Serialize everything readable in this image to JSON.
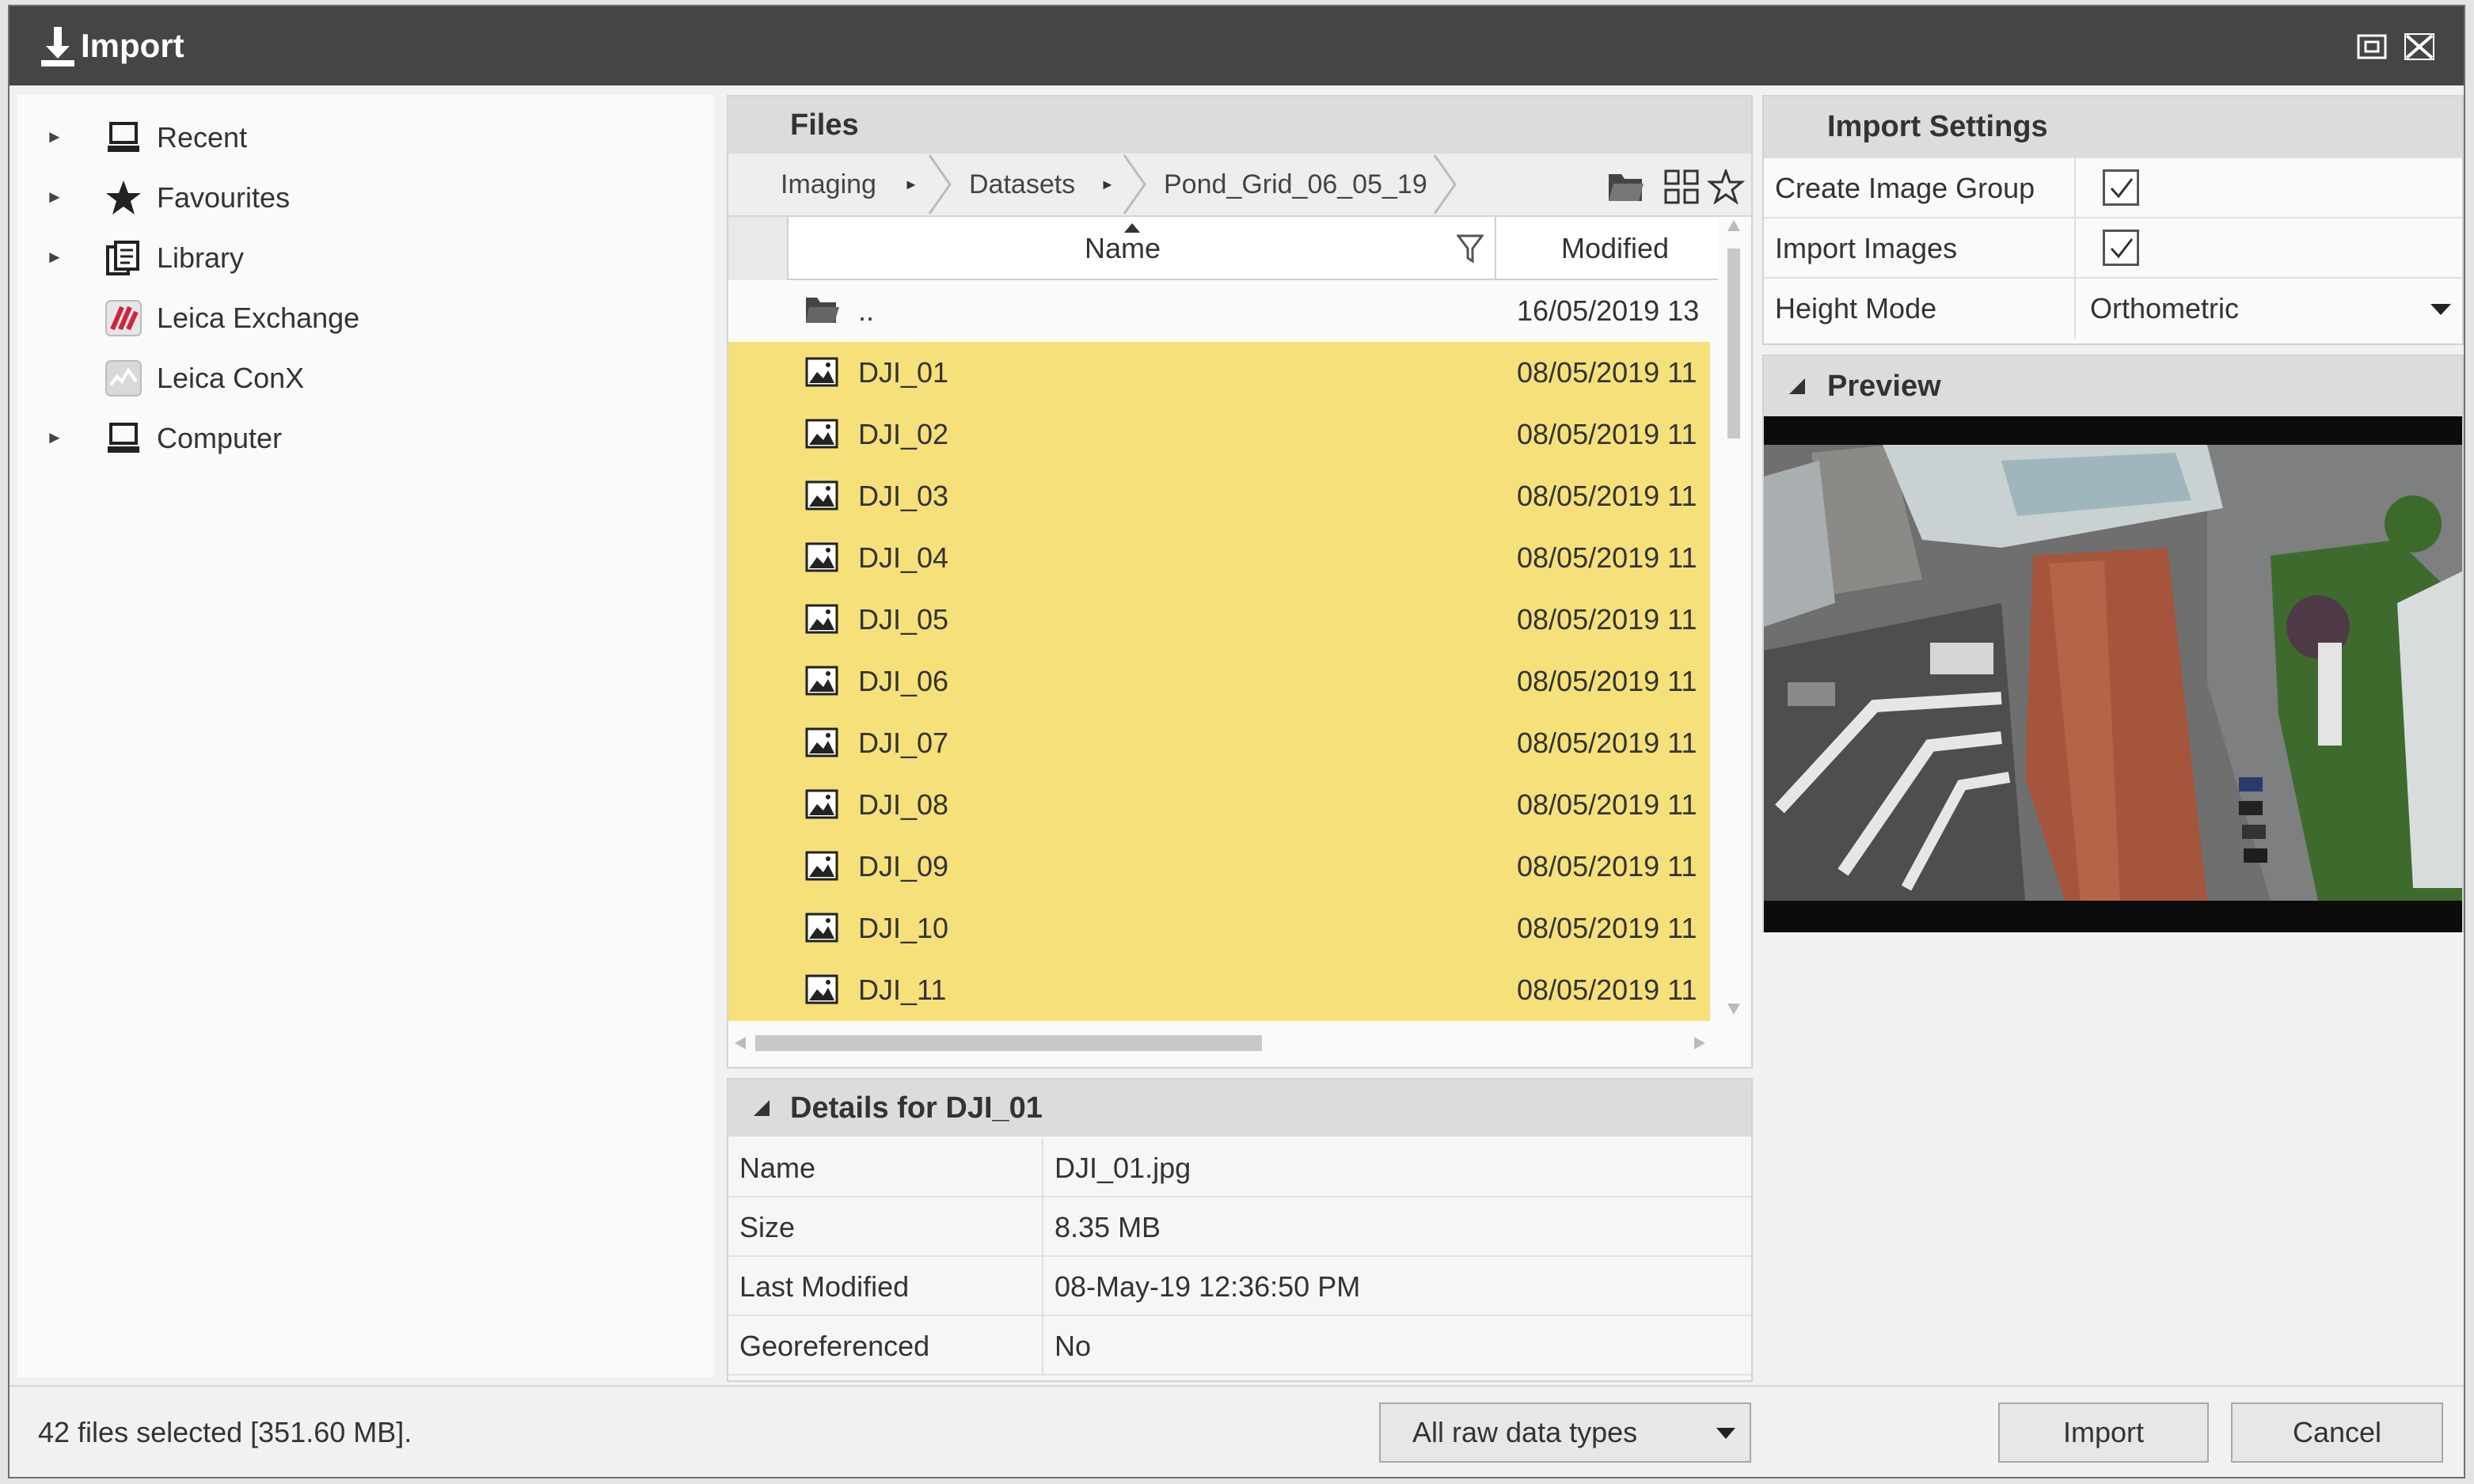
{
  "window": {
    "title": "Import"
  },
  "colors": {
    "title_bar": "#454545",
    "selection": "#f6e07a",
    "panel_header": "#dcdcdc"
  },
  "tree": {
    "items": [
      {
        "label": "Recent",
        "icon": "computer-icon",
        "expandable": true
      },
      {
        "label": "Favourites",
        "icon": "star-icon",
        "expandable": true
      },
      {
        "label": "Library",
        "icon": "library-icon",
        "expandable": true
      },
      {
        "label": "Leica Exchange",
        "icon": "leica-exchange-icon",
        "expandable": false
      },
      {
        "label": "Leica ConX",
        "icon": "leica-conx-icon",
        "expandable": false
      },
      {
        "label": "Computer",
        "icon": "computer-icon",
        "expandable": true
      }
    ]
  },
  "files": {
    "title": "Files",
    "breadcrumb": [
      "Imaging",
      "Datasets",
      "Pond_Grid_06_05_19"
    ],
    "columns": {
      "name": "Name",
      "modified": "Modified"
    },
    "rows": [
      {
        "name": "..",
        "modified": "16/05/2019 13",
        "type": "folder",
        "selected": false
      },
      {
        "name": "DJI_01",
        "modified": "08/05/2019 11",
        "type": "image",
        "selected": true
      },
      {
        "name": "DJI_02",
        "modified": "08/05/2019 11",
        "type": "image",
        "selected": true
      },
      {
        "name": "DJI_03",
        "modified": "08/05/2019 11",
        "type": "image",
        "selected": true
      },
      {
        "name": "DJI_04",
        "modified": "08/05/2019 11",
        "type": "image",
        "selected": true
      },
      {
        "name": "DJI_05",
        "modified": "08/05/2019 11",
        "type": "image",
        "selected": true
      },
      {
        "name": "DJI_06",
        "modified": "08/05/2019 11",
        "type": "image",
        "selected": true
      },
      {
        "name": "DJI_07",
        "modified": "08/05/2019 11",
        "type": "image",
        "selected": true
      },
      {
        "name": "DJI_08",
        "modified": "08/05/2019 11",
        "type": "image",
        "selected": true
      },
      {
        "name": "DJI_09",
        "modified": "08/05/2019 11",
        "type": "image",
        "selected": true
      },
      {
        "name": "DJI_10",
        "modified": "08/05/2019 11",
        "type": "image",
        "selected": true
      },
      {
        "name": "DJI_11",
        "modified": "08/05/2019 11",
        "type": "image",
        "selected": true
      }
    ]
  },
  "details": {
    "title": "Details for DJI_01",
    "rows": [
      {
        "key": "Name",
        "value": "DJI_01.jpg"
      },
      {
        "key": "Size",
        "value": "8.35 MB"
      },
      {
        "key": "Last Modified",
        "value": "08-May-19 12:36:50 PM"
      },
      {
        "key": "Georeferenced",
        "value": "No"
      }
    ]
  },
  "settings": {
    "title": "Import Settings",
    "create_image_group": {
      "label": "Create Image Group",
      "checked": true
    },
    "import_images": {
      "label": "Import Images",
      "checked": true
    },
    "height_mode": {
      "label": "Height Mode",
      "value": "Orthometric"
    }
  },
  "preview": {
    "title": "Preview"
  },
  "footer": {
    "status": "42 files selected [351.60 MB].",
    "data_type": "All raw data types",
    "import_label": "Import",
    "cancel_label": "Cancel"
  }
}
